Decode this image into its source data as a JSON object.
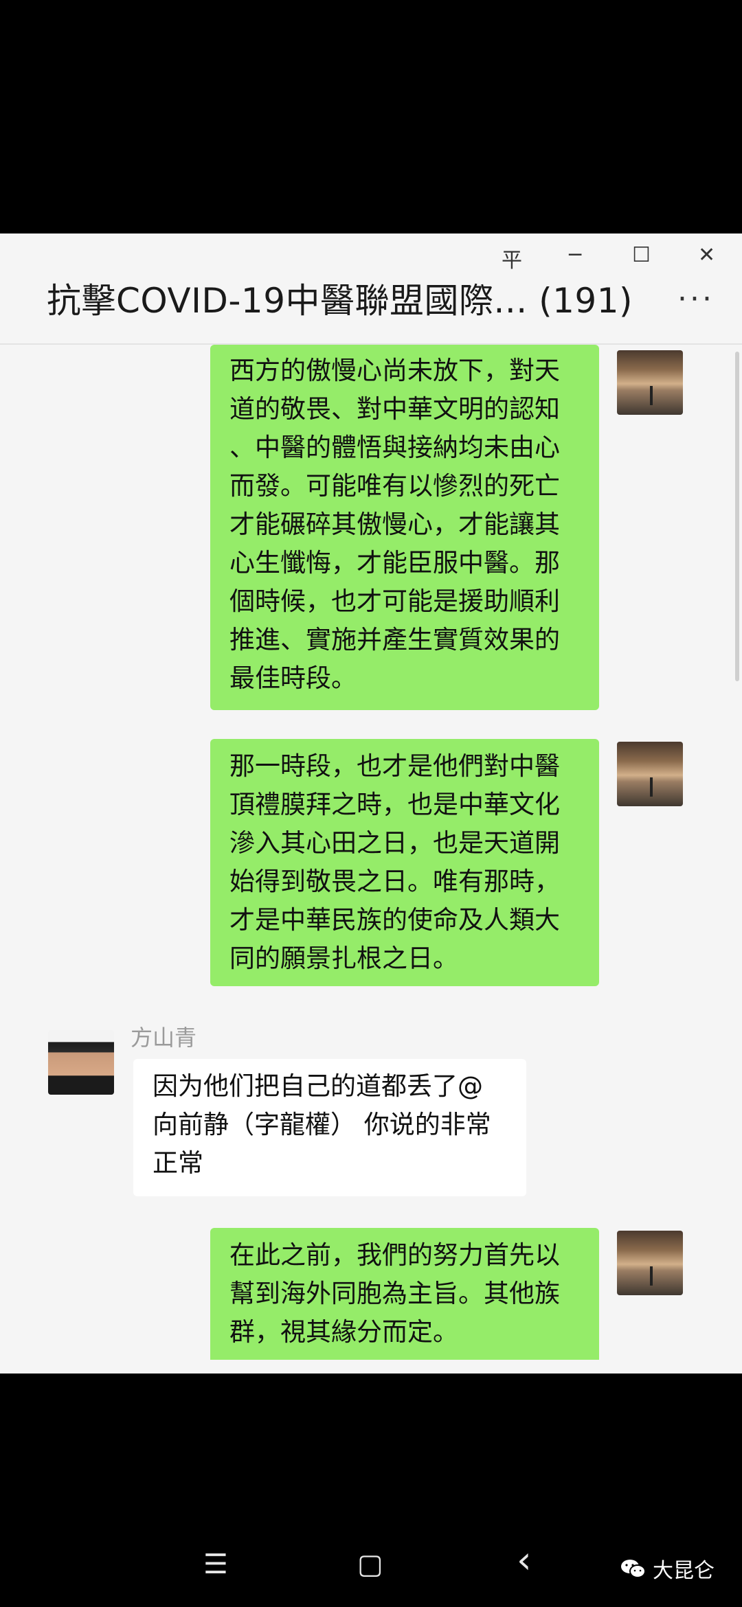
{
  "window": {
    "title": "抗擊COVID-19中醫聯盟國際... (191)",
    "controls": {
      "pin": "平",
      "minimize": "─",
      "maximize": "☐",
      "close": "✕"
    },
    "more": "···"
  },
  "messages": [
    {
      "sender": "me",
      "lines": [
        "西方的傲慢心尚未放下，對天",
        "道的敬畏、對中華文明的認知",
        "、中醫的體悟與接納均未由心",
        "而發。可能唯有以慘烈的死亡",
        "才能碾碎其傲慢心，才能讓其",
        "心生懺悔，才能臣服中醫。那",
        "個時候，也才可能是援助順利",
        "推進、實施并產生實質效果的",
        "最佳時段。"
      ]
    },
    {
      "sender": "me",
      "lines": [
        "那一時段，也才是他們對中醫",
        "頂禮膜拜之時，也是中華文化",
        "滲入其心田之日，也是天道開",
        "始得到敬畏之日。唯有那時，",
        "才是中華民族的使命及人類大",
        "同的願景扎根之日。"
      ]
    },
    {
      "sender_name": "方山青",
      "lines": [
        "因为他们把自己的道都丢了@",
        "向前静（字龍權） 你说的非常",
        "正常"
      ]
    },
    {
      "sender": "me",
      "lines": [
        "在此之前，我們的努力首先以",
        "幫到海外同胞為主旨。其他族",
        "群，視其緣分而定。"
      ]
    }
  ],
  "navbar": {
    "menu_icon": "☰",
    "home_icon": "▢",
    "back_icon": "‹",
    "brand_name": "大昆仑"
  }
}
